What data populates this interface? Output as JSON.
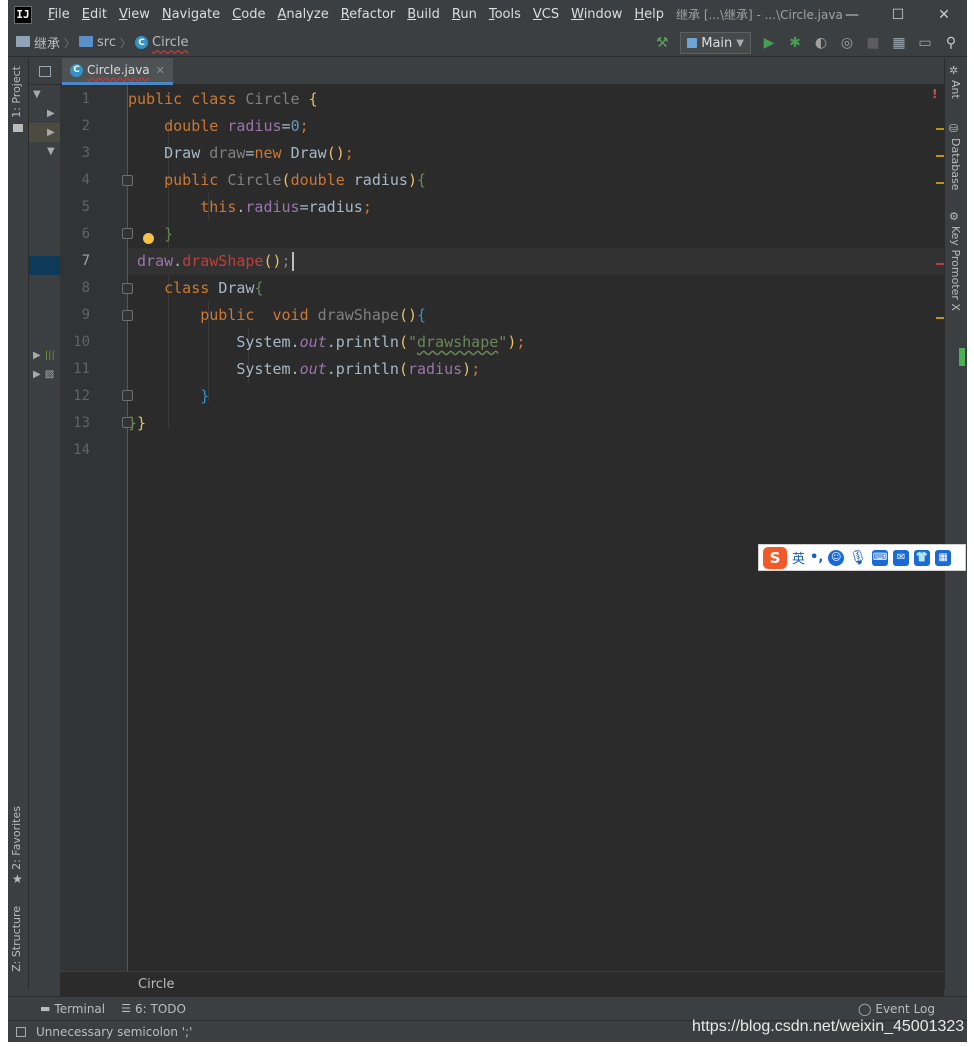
{
  "window": {
    "title": "继承 [...\\继承] - ...\\Circle.java",
    "logo_text": "IJ",
    "controls": [
      "—",
      "☐",
      "✕"
    ]
  },
  "menu": [
    "File",
    "Edit",
    "View",
    "Navigate",
    "Code",
    "Analyze",
    "Refactor",
    "Build",
    "Run",
    "Tools",
    "VCS",
    "Window",
    "Help"
  ],
  "navbar": {
    "crumbs": [
      "继承",
      "src",
      "Circle"
    ],
    "run_config": "Main"
  },
  "left_strip": {
    "project_tab": "1: Project",
    "favorites_tab": "2: Favorites",
    "structure_tab": "Z: Structure"
  },
  "right_strip": {
    "tabs": [
      "Ant",
      "Database",
      "Key Promoter X"
    ]
  },
  "editor": {
    "tab_label": "Circle.java",
    "breadcrumb": "Circle",
    "line_numbers": [
      "1",
      "2",
      "3",
      "4",
      "5",
      "6",
      "7",
      "8",
      "9",
      "10",
      "11",
      "12",
      "13",
      "14"
    ],
    "current_line": 7
  },
  "bottom_bar": {
    "terminal": "Terminal",
    "todo": "6: TODO",
    "event_log": "Event Log"
  },
  "status": {
    "message": "Unnecessary semicolon ';'"
  },
  "ime": {
    "logo": "S",
    "mode": "英"
  },
  "watermark": "https://blog.csdn.net/weixin_45001323",
  "colors": {
    "keyword": "#cc7832",
    "field": "#9876aa",
    "string": "#6a8759",
    "method": "#ffc66d",
    "error": "#bc3f3c",
    "background": "#2b2b2b"
  }
}
